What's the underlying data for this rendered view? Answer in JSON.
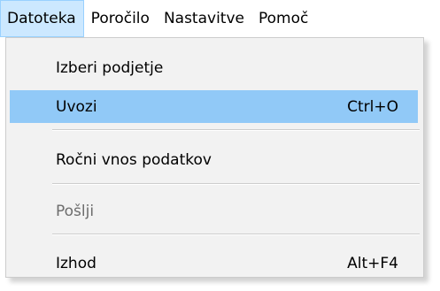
{
  "menubar": {
    "items": [
      {
        "label": "Datoteka"
      },
      {
        "label": "Poročilo"
      },
      {
        "label": "Nastavitve"
      },
      {
        "label": "Pomoč"
      }
    ]
  },
  "file_menu": {
    "items": [
      {
        "label": "Izberi podjetje",
        "shortcut": ""
      },
      {
        "label": "Uvozi",
        "shortcut": "Ctrl+O"
      },
      {
        "label": "Ročni vnos podatkov",
        "shortcut": ""
      },
      {
        "label": "Pošlji",
        "shortcut": ""
      },
      {
        "label": "Izhod",
        "shortcut": "Alt+F4"
      }
    ]
  },
  "colors": {
    "menubar_active_bg": "#cce8ff",
    "menu_highlight_bg": "#91c9f7",
    "menu_bg": "#f2f2f2",
    "disabled_text": "#6d6d6d"
  }
}
